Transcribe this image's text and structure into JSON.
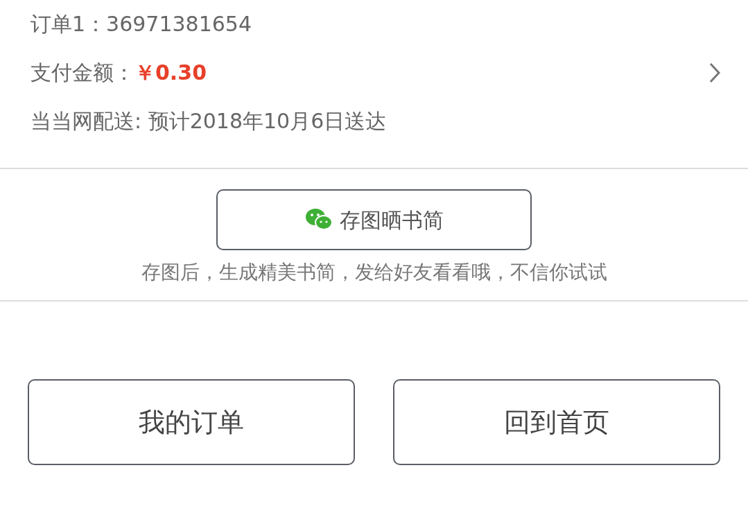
{
  "order": {
    "number_label": "订单1：36971381654",
    "amount_label": "支付金额：",
    "amount": "￥0.30",
    "delivery": "当当网配送: 预计2018年10月6日送达"
  },
  "share": {
    "button": "存图晒书简",
    "caption": "存图后，生成精美书简，发给好友看看哦，不信你试试"
  },
  "buttons": [
    "我的订单",
    "回到首页"
  ]
}
